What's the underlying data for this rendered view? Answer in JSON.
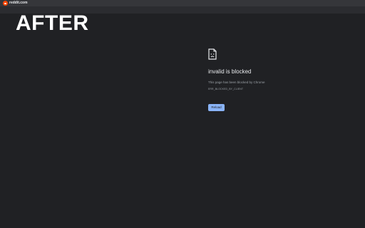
{
  "tab": {
    "title": "reddit.com",
    "favicon": "reddit-icon",
    "favicon_color": "#ff4500"
  },
  "overlay": {
    "label": "AFTER"
  },
  "error_page": {
    "icon": "blocked-page-icon",
    "heading": "invalid is blocked",
    "description": "This page has been blocked by Chrome",
    "error_code": "ERR_BLOCKED_BY_CLIENT",
    "reload_label": "Reload",
    "accent_color": "#8ab4f8"
  }
}
